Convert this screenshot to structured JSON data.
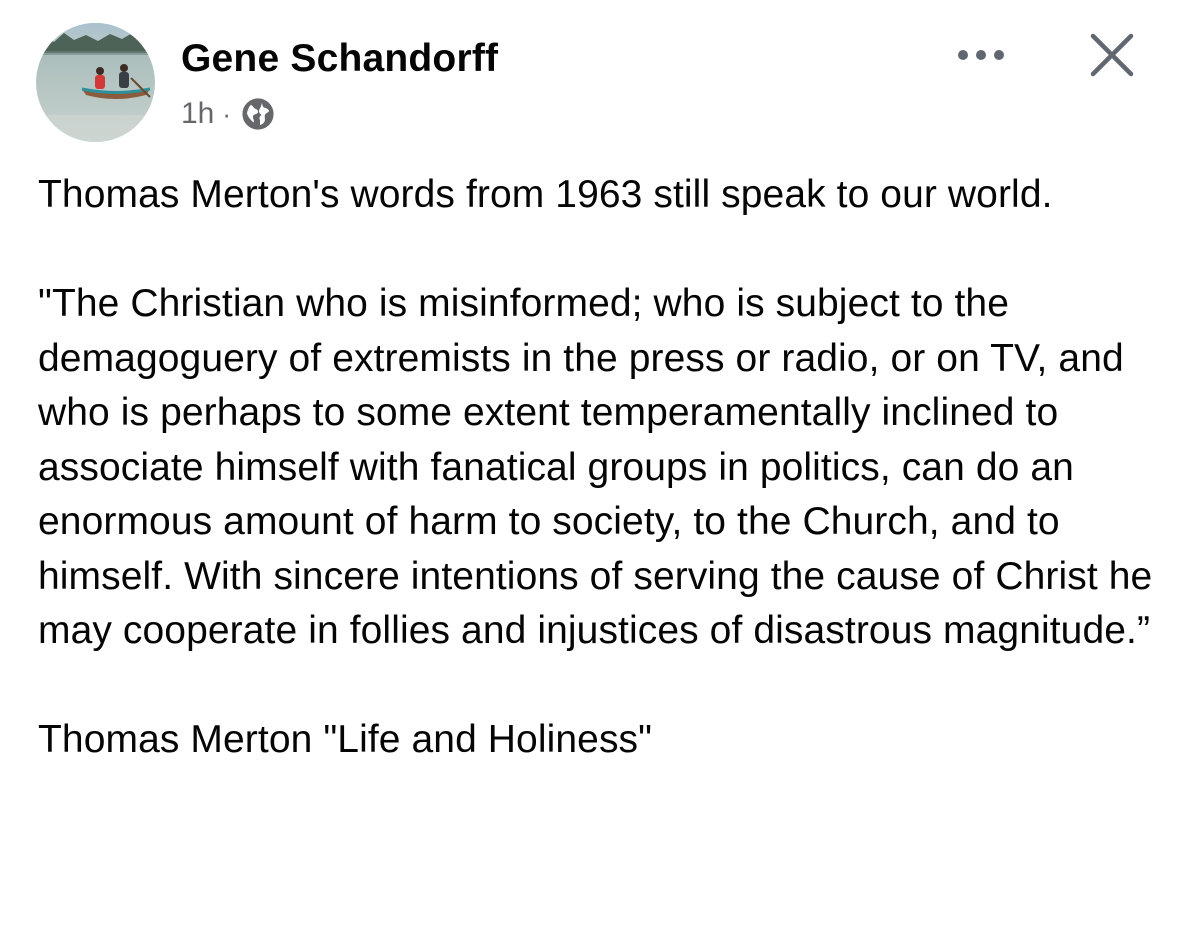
{
  "post": {
    "author": "Gene Schandorff",
    "time": "1h",
    "separator": "·",
    "audience_icon": "globe-icon",
    "more_icon": "more-horizontal-icon",
    "close_icon": "close-icon",
    "avatar_icon": "profile-photo-canoe-on-lake",
    "text": {
      "intro": "Thomas Merton's words from 1963 still speak to our world.",
      "quote": "\"The Christian who is misinformed; who is subject to the demagoguery of extremists in the press or radio, or on TV, and who is perhaps to some extent temperamentally inclined to associate himself with fanatical groups in politics, can do an enormous amount of harm to society, to the Church, and to himself. With sincere intentions of serving the cause of Christ he may cooperate in follies and injustices of disastrous magnitude.”",
      "attribution": "Thomas Merton \"Life and Holiness\""
    }
  },
  "colors": {
    "text": "#050505",
    "secondary_text": "#65676b",
    "icon": "#606770"
  }
}
